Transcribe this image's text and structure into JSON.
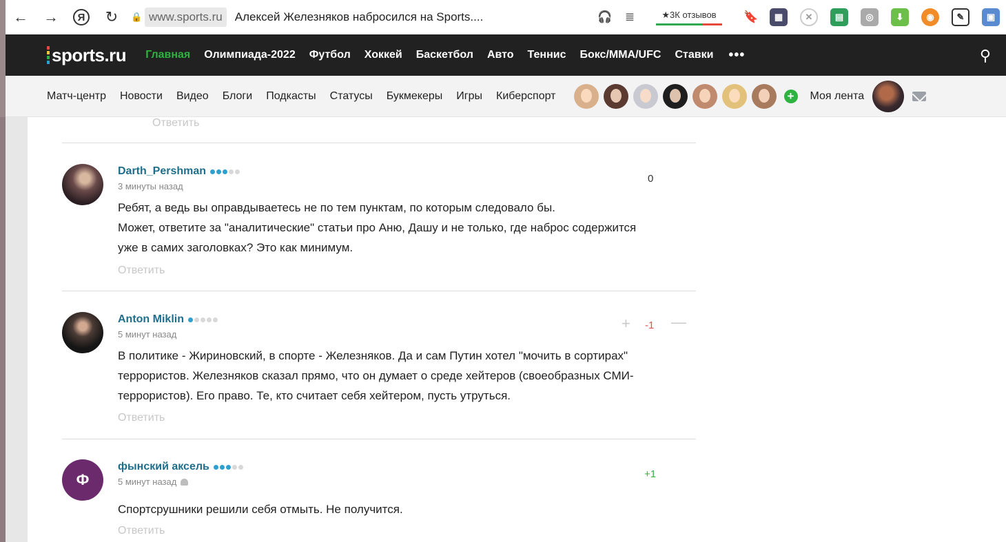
{
  "browser": {
    "domain": "www.sports.ru",
    "tab_title": "Алексей Железняков набросился на Sports....",
    "reviews": "★3К отзывов",
    "yandex_letter": "Я"
  },
  "site": {
    "logo": "sports.ru",
    "top_nav": [
      "Главная",
      "Олимпиада-2022",
      "Футбол",
      "Хоккей",
      "Баскетбол",
      "Авто",
      "Теннис",
      "Бокс/MMA/UFC",
      "Ставки"
    ],
    "more": "•••",
    "sub_nav": [
      "Матч-центр",
      "Новости",
      "Видео",
      "Блоги",
      "Подкасты",
      "Статусы",
      "Букмекеры",
      "Игры",
      "Киберспорт"
    ],
    "add_fav": "+",
    "my_feed": "Моя лента",
    "colors": {
      "active": "#2eb341",
      "author": "#1f6e8c",
      "nav_bg": "#212121"
    }
  },
  "comments": {
    "reply_top": "Ответить",
    "items": [
      {
        "author": "Darth_Pershman",
        "time": "3 минуты назад",
        "rating": "0",
        "lines": [
          "Ребят, а ведь вы оправдываетесь не по тем пунктам, по которым следовало бы.",
          "Может, ответите за \"аналитические\" статьи про Аню, Дашу и не только, где наброс содержится",
          "уже в самих заголовках? Это как минимум."
        ],
        "reply": "Ответить"
      },
      {
        "author": "Anton Miklin",
        "time": "5 минут назад",
        "rating": "-1",
        "lines": [
          "В политике - Жириновский, в спорте - Железняков. Да и сам Путин хотел \"мочить в сортирах\"",
          "террористов. Железняков сказал прямо, что он думает о среде хейтеров (своеобразных СМИ-",
          "террористов). Его право. Те, кто считает себя хейтером, пусть утруться."
        ],
        "reply": "Ответить"
      },
      {
        "author": "фынский аксель",
        "avatar_letter": "Ф",
        "time": "5 минут назад",
        "rating": "+1",
        "lines": [
          "Спортсрушники решили себя отмыть. Не получится."
        ],
        "reply": "Ответить"
      }
    ]
  }
}
